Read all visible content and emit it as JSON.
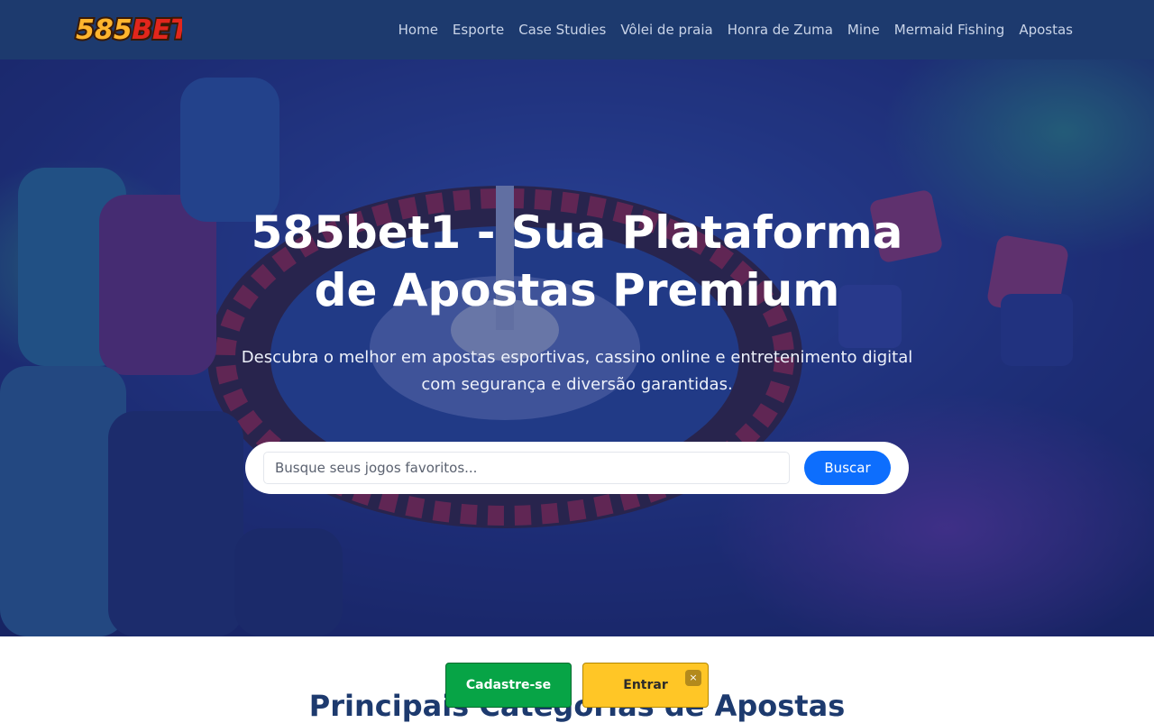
{
  "header": {
    "logo_text": "585BET1",
    "nav": [
      {
        "label": "Home"
      },
      {
        "label": "Esporte"
      },
      {
        "label": "Case Studies"
      },
      {
        "label": "Vôlei de praia"
      },
      {
        "label": "Honra de Zuma"
      },
      {
        "label": "Mine"
      },
      {
        "label": "Mermaid Fishing"
      },
      {
        "label": "Apostas"
      }
    ]
  },
  "hero": {
    "title": "585bet1 - Sua Plataforma de Apostas Premium",
    "subtitle": "Descubra o melhor em apostas esportivas, cassino online e entretenimento digital com segurança e diversão garantidas.",
    "search": {
      "placeholder": "Busque seus jogos favoritos...",
      "value": "",
      "button_label": "Buscar"
    }
  },
  "section": {
    "heading": "Principais Categorias de Apostas"
  },
  "floating_bar": {
    "register_label": "Cadastre-se",
    "login_label": "Entrar",
    "close_icon": "×"
  },
  "colors": {
    "header_bg": "#1d3a6e",
    "search_button": "#0d6efd",
    "register_button": "#07a446",
    "login_button": "#ffc626",
    "heading": "#1d3a6e"
  },
  "icons": {
    "logo": "585bet1-logo",
    "close": "close-icon"
  }
}
